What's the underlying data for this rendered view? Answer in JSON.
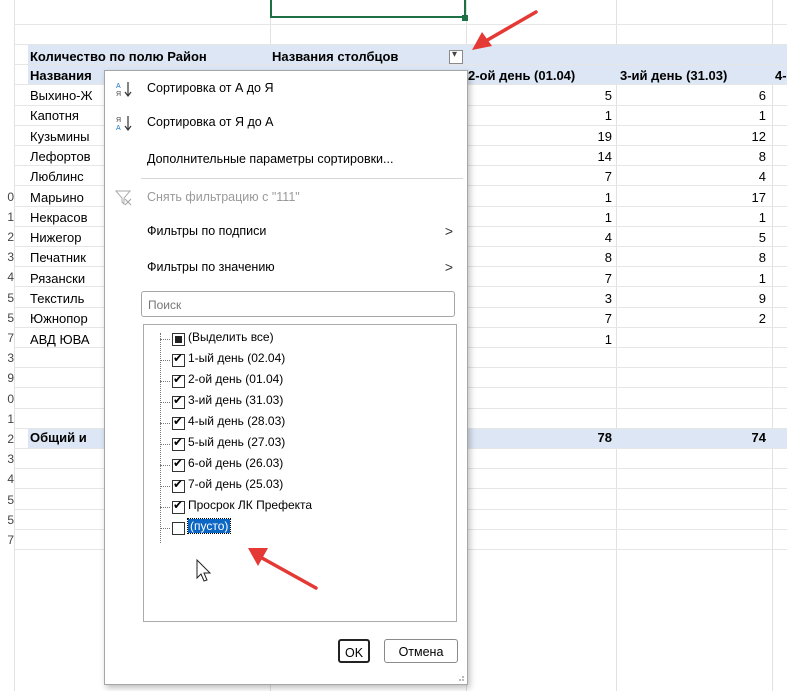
{
  "sheet": {
    "row_numbers": [
      "",
      "",
      "",
      "",
      "",
      "",
      "",
      "",
      "",
      "0",
      "1",
      "2",
      "3",
      "4",
      "5",
      "5",
      "7",
      "3",
      "9",
      "0",
      "1",
      "2",
      "3",
      "4",
      "5",
      "5",
      "7"
    ],
    "pivot_header": {
      "values_label": "Количество по полю Район",
      "columns_label": "Названия столбцов",
      "filter_glyph": "▾"
    },
    "col_headers": [
      "Названия",
      "2-ой день (01.04)",
      "3-ий день (31.03)",
      "4-"
    ],
    "rows": [
      {
        "name": "Выхино-Ж",
        "c2": "5",
        "c3": "6"
      },
      {
        "name": "Капотня",
        "c2": "1",
        "c3": "1"
      },
      {
        "name": "Кузьмины",
        "c2": "19",
        "c3": "12"
      },
      {
        "name": "Лефортов",
        "c2": "14",
        "c3": "8"
      },
      {
        "name": "Люблинс",
        "c2": "7",
        "c3": "4"
      },
      {
        "name": "Марьино",
        "c2": "1",
        "c3": "17"
      },
      {
        "name": "Некрасов",
        "c2": "1",
        "c3": "1"
      },
      {
        "name": "Нижегор",
        "c2": "4",
        "c3": "5"
      },
      {
        "name": "Печатник",
        "c2": "8",
        "c3": "8"
      },
      {
        "name": "Рязански",
        "c2": "7",
        "c3": "1"
      },
      {
        "name": "Текстиль",
        "c2": "3",
        "c3": "9"
      },
      {
        "name": "Южнопор",
        "c2": "7",
        "c3": "2"
      },
      {
        "name": "АВД ЮВА",
        "c2": "1",
        "c3": ""
      }
    ],
    "total": {
      "name": "Общий и",
      "c2": "78",
      "c3": "74"
    }
  },
  "popup": {
    "sort_az": "Сортировка от А до Я",
    "sort_za": "Сортировка от Я до А",
    "sort_more": "Дополнительные параметры сортировки...",
    "clear_filter": "Снять фильтрацию с \"111\"",
    "label_filters": "Фильтры по подписи",
    "value_filters": "Фильтры по значению",
    "submenu_arrow": ">",
    "search_placeholder": "Поиск",
    "items": [
      {
        "label": "(Выделить все)",
        "state": "mixed"
      },
      {
        "label": "1-ый день (02.04)",
        "state": "checked"
      },
      {
        "label": "2-ой день (01.04)",
        "state": "checked"
      },
      {
        "label": "3-ий день (31.03)",
        "state": "checked"
      },
      {
        "label": "4-ый день (28.03)",
        "state": "checked"
      },
      {
        "label": "5-ый день (27.03)",
        "state": "checked"
      },
      {
        "label": "6-ой день (26.03)",
        "state": "checked"
      },
      {
        "label": "7-ой день (25.03)",
        "state": "checked"
      },
      {
        "label": "Просрок ЛК Префекта",
        "state": "checked"
      },
      {
        "label": "(пусто)",
        "state": "unchecked"
      }
    ],
    "ok": "OK",
    "cancel": "Отмена"
  },
  "colors": {
    "pivot_band": "#dce6f4",
    "selection": "#0b66c4",
    "arrow": "#e53935",
    "cell_border_green": "#1e7145"
  }
}
